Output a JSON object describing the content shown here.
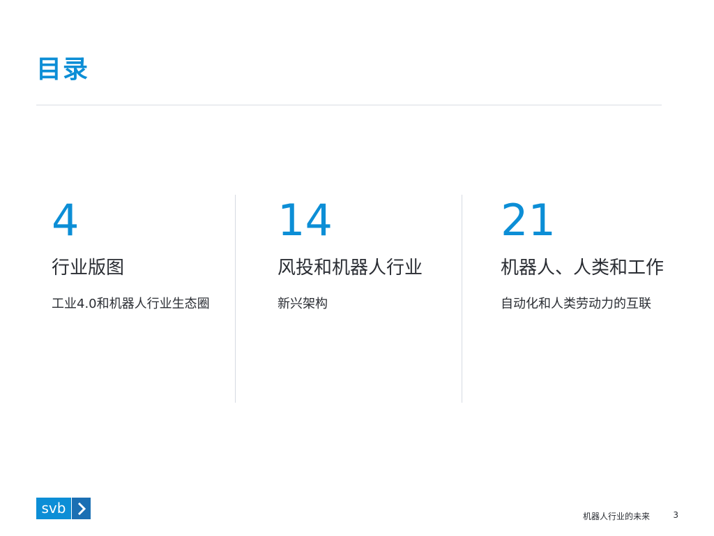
{
  "colors": {
    "accent": "#0c8ed6"
  },
  "page": {
    "title": "目录"
  },
  "sections": [
    {
      "number": "4",
      "heading": "行业版图",
      "subtitle": "工业4.0和机器人行业生态圈"
    },
    {
      "number": "14",
      "heading": "风投和机器人行业",
      "subtitle": "新兴架构"
    },
    {
      "number": "21",
      "heading": "机器人、人类和工作",
      "subtitle": "自动化和人类劳动力的互联"
    }
  ],
  "footer": {
    "logo_text": "svb",
    "logo_icon": "chevron-right-icon",
    "text": "机器人行业的未来",
    "page_number": "3"
  }
}
